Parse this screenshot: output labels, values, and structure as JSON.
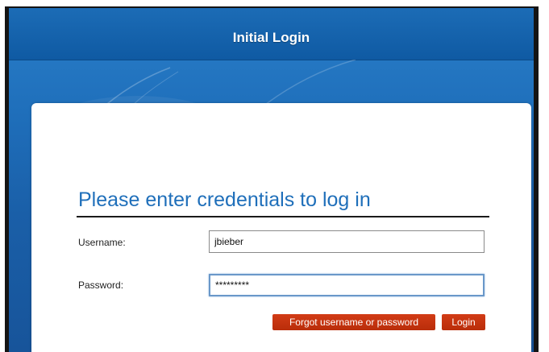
{
  "window": {
    "title": "Initial Login"
  },
  "form": {
    "heading": "Please enter credentials to log in",
    "username_label": "Username:",
    "username_value": "jbieber",
    "password_label": "Password:",
    "password_value": "*********"
  },
  "buttons": {
    "forgot": "Forgot username or password",
    "login": "Login"
  },
  "colors": {
    "title_bar": "#1565b0",
    "heading": "#1f6fba",
    "button": "#c1340f",
    "panel": "#ffffff"
  }
}
